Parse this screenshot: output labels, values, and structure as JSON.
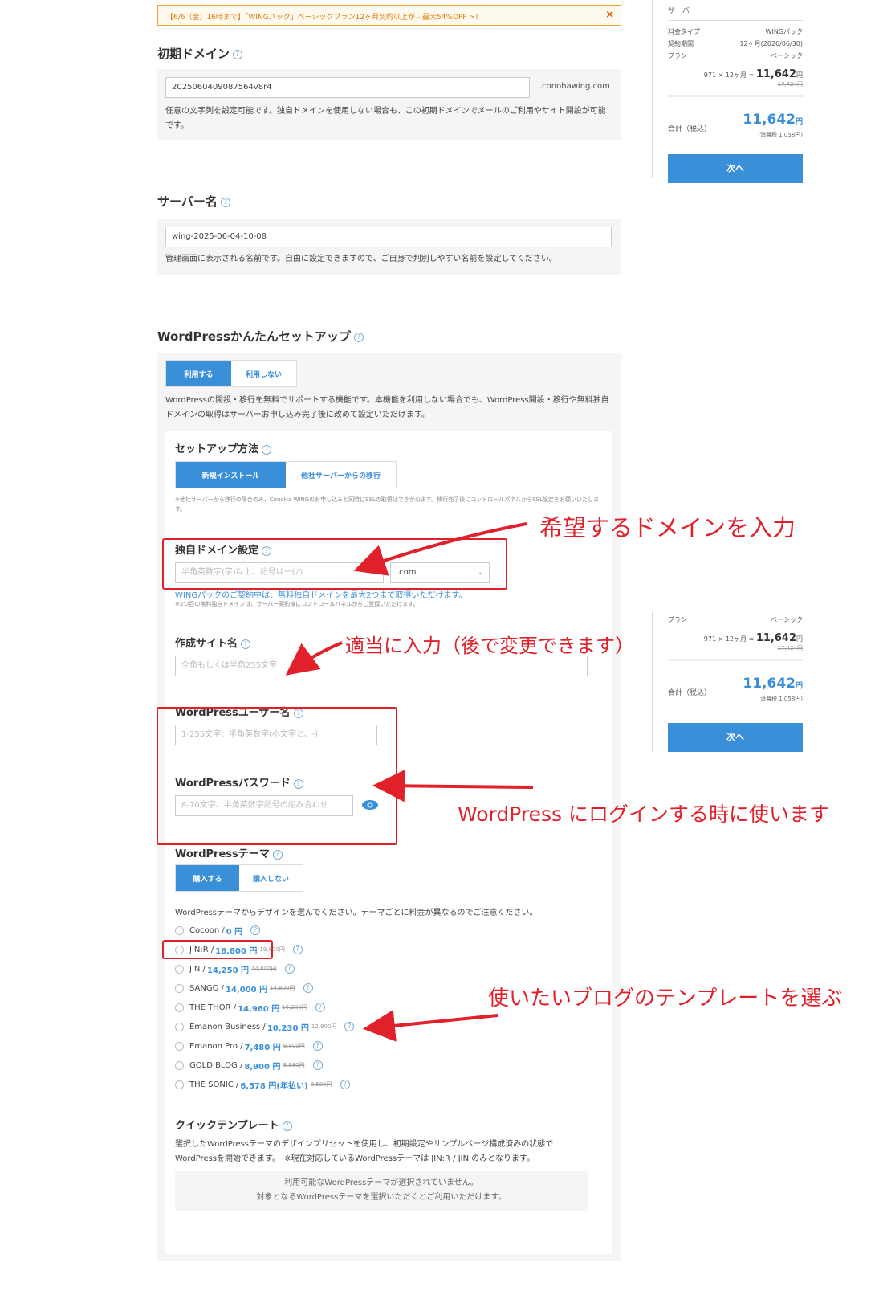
{
  "banner": {
    "text": "【6/6（金）16時まで】「WINGパック」ベーシックプラン12ヶ月契約以上が - 最大54%OFF >！",
    "close": "×"
  },
  "initial_domain": {
    "heading": "初期ドメイン",
    "value": "20250604090875​64v8r4",
    "suffix": ".conohawing.com",
    "desc": "任意の文字列を設定可能です。独自ドメインを使用しない場合も、この初期ドメインでメールのご利用やサイト開設が可能です。"
  },
  "server_name": {
    "heading": "サーバー名",
    "value": "wing-2025-06-04-10-08",
    "desc": "管理画面に表示される名前です。自由に設定できますので、ご自身で判別しやすい名前を設定してください。"
  },
  "wordpress_setup": {
    "heading": "WordPressかんたんセットアップ",
    "use_label": "利用する",
    "nouse_label": "利用しない",
    "desc": "WordPressの開設・移行を無料でサポートする機能です。本機能を利用しない場合でも、WordPress開設・移行や無料独自ドメインの取得はサーバーお申し込み完了後に改めて設定いただけます。",
    "method_heading": "セットアップ方法",
    "method_new": "新規インストール",
    "method_migrate": "他社サーバーからの移行",
    "method_note": "※他社サーバーから移行の場合のみ、ConoHa WINGのお申し込みと同時にSSLの取得はできかねます。移行完了後にコントロールパネルからSSL設定をお願いいたします。",
    "domain_heading": "独自ドメイン設定",
    "domain_placeholder": "半角英数字(字)以上、記号は一(ハ",
    "domain_tld": ".com",
    "domain_link": "WINGパックのご契約中は、無料独自ドメインを最大2つまで取得いただけます。",
    "domain_note": "※2つ目の無料独自ドメインは、サーバー契約後にコントロールパネルからご登録いただけます。",
    "site_heading": "作成サイト名",
    "site_placeholder": "全角もしくは半角255文字",
    "user_heading": "WordPressユーザー名",
    "user_placeholder": "1-255文字、半角英数字(小文字と、-)",
    "pass_heading": "WordPressパスワード",
    "pass_placeholder": "8-70文字、半角英数字記号の組み合わせ",
    "theme_heading": "WordPressテーマ",
    "theme_buy": "購入する",
    "theme_nobuy": "購入しない",
    "theme_desc": "WordPressテーマからデザインを選んでください。テーマごとに料金が異なるのでご注意ください。",
    "themes": [
      {
        "name": "Cocoon / ",
        "price": "0 円",
        "old": ""
      },
      {
        "name": "JIN:R / ",
        "price": "18,800 円",
        "old": "19,800円"
      },
      {
        "name": "JIN / ",
        "price": "14,250 円",
        "old": "14,800円"
      },
      {
        "name": "SANGO / ",
        "price": "14,000 円",
        "old": "14,800円"
      },
      {
        "name": "THE THOR / ",
        "price": "14,960 円",
        "old": "16,280円"
      },
      {
        "name": "Emanon Business / ",
        "price": "10,230 円",
        "old": "12,800円"
      },
      {
        "name": "Emanon Pro / ",
        "price": "7,480 円",
        "old": "9,800円"
      },
      {
        "name": "GOLD BLOG / ",
        "price": "8,900 円",
        "old": "9,980円"
      },
      {
        "name": "THE SONIC / ",
        "price": "6,578 円(年払い)",
        "old": "8,580円"
      }
    ],
    "quick_heading": "クイックテンプレート",
    "quick_desc": "選択したWordPressテーマのデザインプリセットを使用し、初期設定やサンプルページ構成済みの状態でWordPressを開始できます。　※現在対応しているWordPressテーマは JIN:R / JIN のみとなります。",
    "quick_empty1": "利用可能なWordPressテーマが選択されていません。",
    "quick_empty2": "対象となるWordPressテーマを選択いただくとご利用いただけます。"
  },
  "sidebar_top": {
    "section": "サーバー",
    "rows": [
      {
        "k": "料金タイプ",
        "v": "WINGパック"
      },
      {
        "k": "契約期間",
        "v": "12ヶ月(2026/06/30)"
      },
      {
        "k": "プラン",
        "v": "ベーシック"
      }
    ],
    "calc": "971 × 12ヶ月",
    "amount": "11,642",
    "yen": "円",
    "old": "17,424円",
    "total_label": "合計（税込）",
    "total": "11,642",
    "tax": "(消費税 1,058円)",
    "next": "次へ"
  },
  "sidebar_bottom": {
    "row": {
      "k": "プラン",
      "v": "ベーシック"
    },
    "calc": "971 × 12ヶ月",
    "amount": "11,642",
    "yen": "円",
    "old": "17,424円",
    "total_label": "合計（税込）",
    "total": "11,642",
    "tax": "(消費税 1,058円)",
    "next": "次へ"
  },
  "annotations": {
    "domain": "希望するドメインを入力",
    "site": "適当に入力（後で変更できます）",
    "login": "WordPress にログインする時に使います",
    "theme": "使いたいブログのテンプレートを選ぶ"
  },
  "colors": {
    "accent": "#3a8fd9",
    "annotation": "#e0202a",
    "banner": "#e07a00"
  }
}
